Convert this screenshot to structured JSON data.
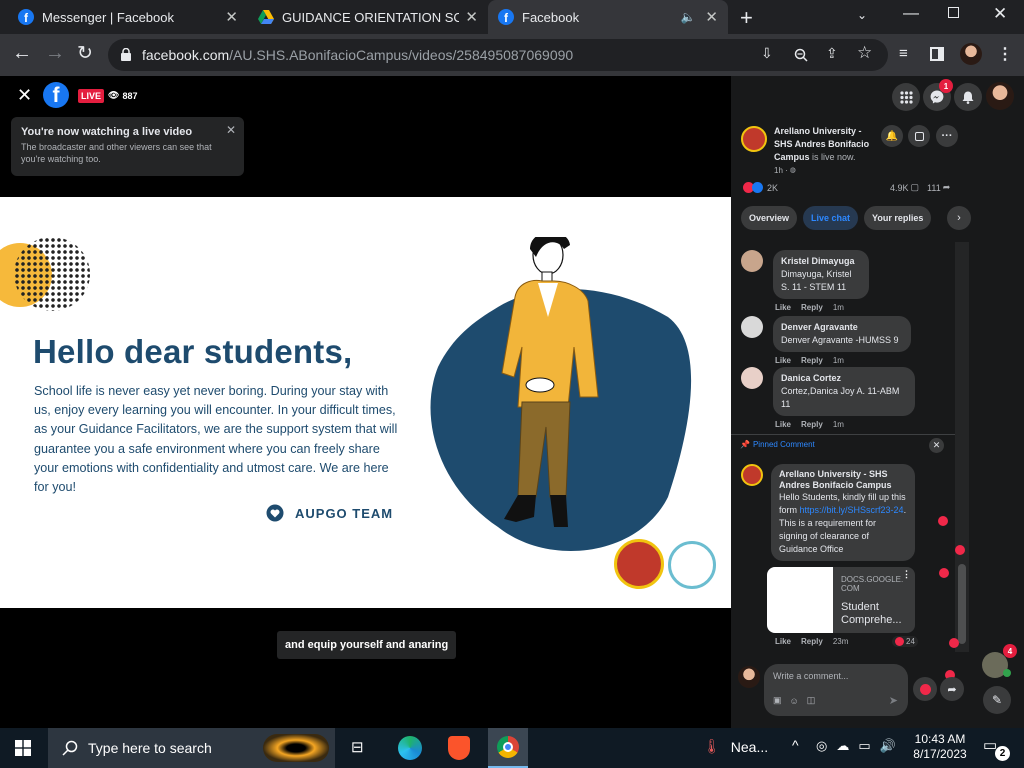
{
  "browser": {
    "tabs": [
      {
        "title": "Messenger | Facebook",
        "icon": "facebook-icon"
      },
      {
        "title": "GUIDANCE ORIENTATION SCREEN",
        "icon": "google-drive-icon"
      },
      {
        "title": "Facebook",
        "icon": "facebook-icon",
        "active": true
      }
    ],
    "url_domain": "facebook.com",
    "url_path": "/AU.SHS.ABonifacioCampus/videos/258495087069090"
  },
  "video": {
    "live_badge": "LIVE",
    "viewers": "887",
    "notice": {
      "title": "You're now watching a live video",
      "body": "The broadcaster and other viewers can see that you're watching too."
    },
    "slide": {
      "heading": "Hello dear students,",
      "body": "School life is never easy yet never boring. During your stay with us, enjoy every learning you will encounter. In your difficult times, as your Guidance Facilitators, we are the support system that will guarantee you a safe environment where you can freely share your emotions with confidentiality and utmost care. We are here for you!",
      "team": "AUPGO TEAM"
    },
    "caption": "and equip yourself and anaring"
  },
  "panel": {
    "header_notification_count": "1",
    "page_name": "Arellano University - SHS Andres Bonifacio Campus",
    "live_text": "is live now.",
    "time": "1h ·",
    "reactions": "2K",
    "comments_count": "4.9K",
    "shares_count": "111",
    "tabs": [
      "Overview",
      "Live chat",
      "Your replies"
    ],
    "comments": [
      {
        "name": "Kristel Dimayuga",
        "text": "Dimayuga, Kristel S. 11 - STEM 11",
        "time": "1m"
      },
      {
        "name": "Denver Agravante",
        "text": "Denver Agravante -HUMSS 9",
        "time": "1m"
      },
      {
        "name": "Danica Cortez",
        "text": "Cortez,Danica Joy A. 11-ABM 11",
        "time": "1m"
      }
    ],
    "actions": {
      "like": "Like",
      "reply": "Reply"
    },
    "pinned": {
      "label": "Pinned Comment",
      "name": "Arellano University - SHS Andres Bonifacio Campus",
      "text1": "Hello Students, kindly fill up this form",
      "link": "https://bit.ly/SHSscrf23-24",
      "text2": ". This is a requirement for signing of clearance of Guidance Office",
      "preview_domain": "DOCS.GOOGLE.COM",
      "preview_title": "Student Comprehe...",
      "reaction_count": "24",
      "time": "23m"
    },
    "composer_placeholder": "Write a comment...",
    "chat_head_badge": "4"
  },
  "taskbar": {
    "search_placeholder": "Type here to search",
    "weather": "Nea...",
    "time": "10:43 AM",
    "date": "8/17/2023",
    "notification_count": "2"
  },
  "colors": {
    "fb_blue": "#1877f2",
    "slide_navy": "#1e4b6e",
    "blazer": "#f2b53a",
    "like_red": "#f02849"
  }
}
